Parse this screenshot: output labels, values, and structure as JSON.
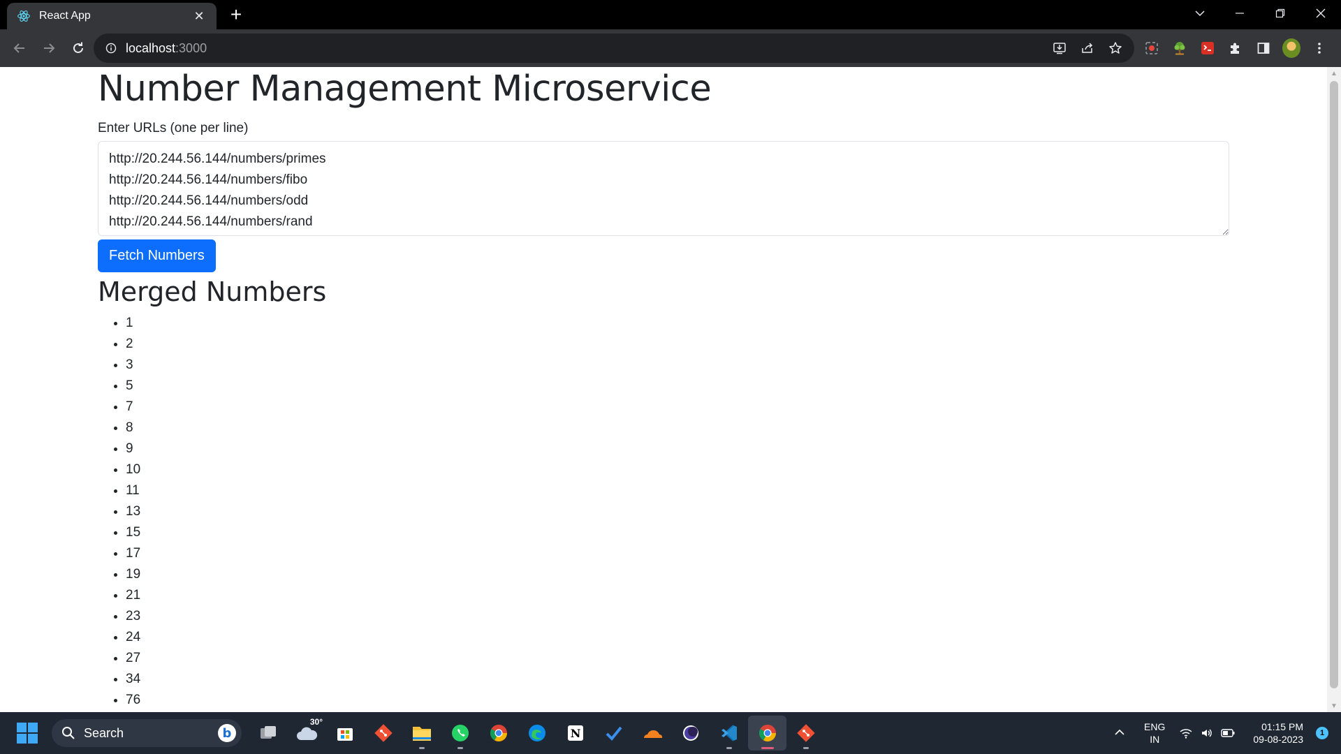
{
  "browser": {
    "tab_title": "React App",
    "url_host": "localhost",
    "url_port": ":3000"
  },
  "page": {
    "title": "Number Management Microservice",
    "urls_label": "Enter URLs (one per line)",
    "urls_value": "http://20.244.56.144/numbers/primes\nhttp://20.244.56.144/numbers/fibo\nhttp://20.244.56.144/numbers/odd\nhttp://20.244.56.144/numbers/rand",
    "fetch_button": "Fetch Numbers",
    "merged_title": "Merged Numbers",
    "numbers": [
      "1",
      "2",
      "3",
      "5",
      "7",
      "8",
      "9",
      "10",
      "11",
      "13",
      "15",
      "17",
      "19",
      "21",
      "23",
      "24",
      "27",
      "34",
      "76"
    ]
  },
  "taskbar": {
    "search_placeholder": "Search",
    "weather_temp": "30°",
    "language": "ENG",
    "region": "IN",
    "time": "01:15 PM",
    "date": "09-08-2023",
    "notification_count": "1",
    "apps": [
      "task-view",
      "weather",
      "microsoft-store",
      "git",
      "file-explorer",
      "whatsapp",
      "chrome",
      "edge",
      "notion",
      "todo",
      "cloudflare",
      "eclipse",
      "vscode",
      "chrome-active",
      "git-2"
    ]
  },
  "colors": {
    "primary_button": "#0d6efd",
    "text": "#212529",
    "chrome_toolbar": "#35363a"
  }
}
